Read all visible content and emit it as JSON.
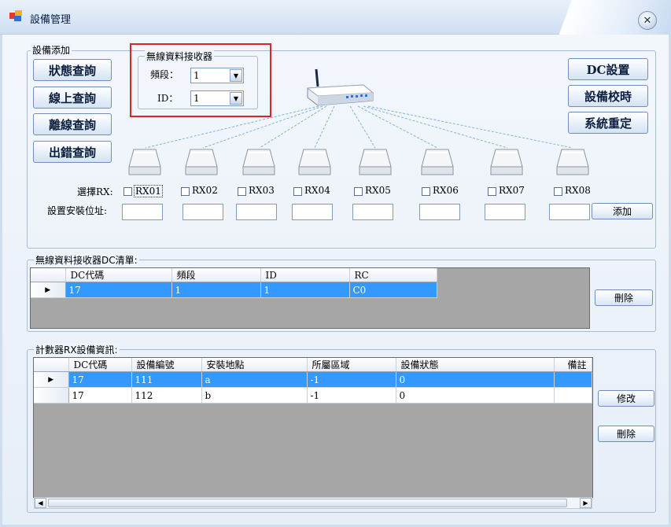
{
  "window": {
    "title": "設備管理",
    "close_glyph": "✕"
  },
  "device_add": {
    "group_label": "設備添加",
    "query_buttons": [
      "狀態查詢",
      "線上查詢",
      "離線查詢",
      "出錯查詢"
    ],
    "right_buttons": [
      "DC設置",
      "設備校時",
      "系統重定"
    ],
    "receiver": {
      "group_label": "無線資料接收器",
      "band_label": "頻段：",
      "band_value": "1",
      "id_label": "ID：",
      "id_value": "1"
    },
    "select_rx_label": "選擇RX:",
    "install_addr_label": "設置安裝位址:",
    "rx_items": [
      "RX01",
      "RX02",
      "RX03",
      "RX04",
      "RX05",
      "RX06",
      "RX07",
      "RX08"
    ],
    "add_button": "添加"
  },
  "dc_list": {
    "group_label": "無線資料接收器DC清單:",
    "columns": [
      "DC代碼",
      "頻段",
      "ID",
      "RC"
    ],
    "rows": [
      [
        "17",
        "1",
        "1",
        "C0"
      ]
    ],
    "delete_button": "刪除"
  },
  "rx_info": {
    "group_label": "計數器RX設備資訊:",
    "columns": [
      "DC代碼",
      "設備編號",
      "安裝地點",
      "所屬區域",
      "設備狀態",
      "備註"
    ],
    "rows": [
      [
        "17",
        "111",
        "a",
        "-1",
        "0",
        ""
      ],
      [
        "17",
        "112",
        "b",
        "-1",
        "0",
        ""
      ]
    ],
    "edit_button": "修改",
    "delete_button": "刪除"
  },
  "colors": {
    "selection": "#3399ff",
    "highlight_box": "#d9262a",
    "grid_bg": "#a6a6a6"
  },
  "icons": {
    "app": "app-icon",
    "router": "router-icon",
    "rx_device": "rx-device-icon"
  }
}
